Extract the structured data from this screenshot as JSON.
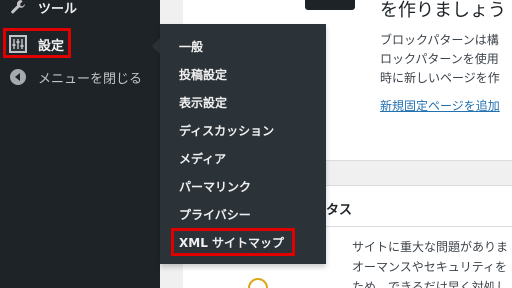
{
  "sidebar": {
    "tools_label": "ツール",
    "settings_label": "設定",
    "close_menu_label": "メニューを閉じる"
  },
  "submenu": {
    "items": [
      "一般",
      "投稿設定",
      "表示設定",
      "ディスカッション",
      "メディア",
      "パーマリンク",
      "プライバシー",
      "XML サイトマップ"
    ]
  },
  "main": {
    "heading": "を作りましょう",
    "paragraph_lines": [
      "ブロックパターンは構",
      "ロックパターンを使用",
      "時に新しいページを作"
    ],
    "link": "新規固定ページを追加",
    "status_title": "タス",
    "status_lines": [
      "サイトに重大な問題がありま",
      "オーマンスやセキュリティを",
      "ため、できるだけ早く対処し"
    ]
  },
  "colors": {
    "highlight": "#e00000",
    "sidebar_bg": "#1d2327",
    "flyout_bg": "#2c3338",
    "link": "#2271b1"
  }
}
